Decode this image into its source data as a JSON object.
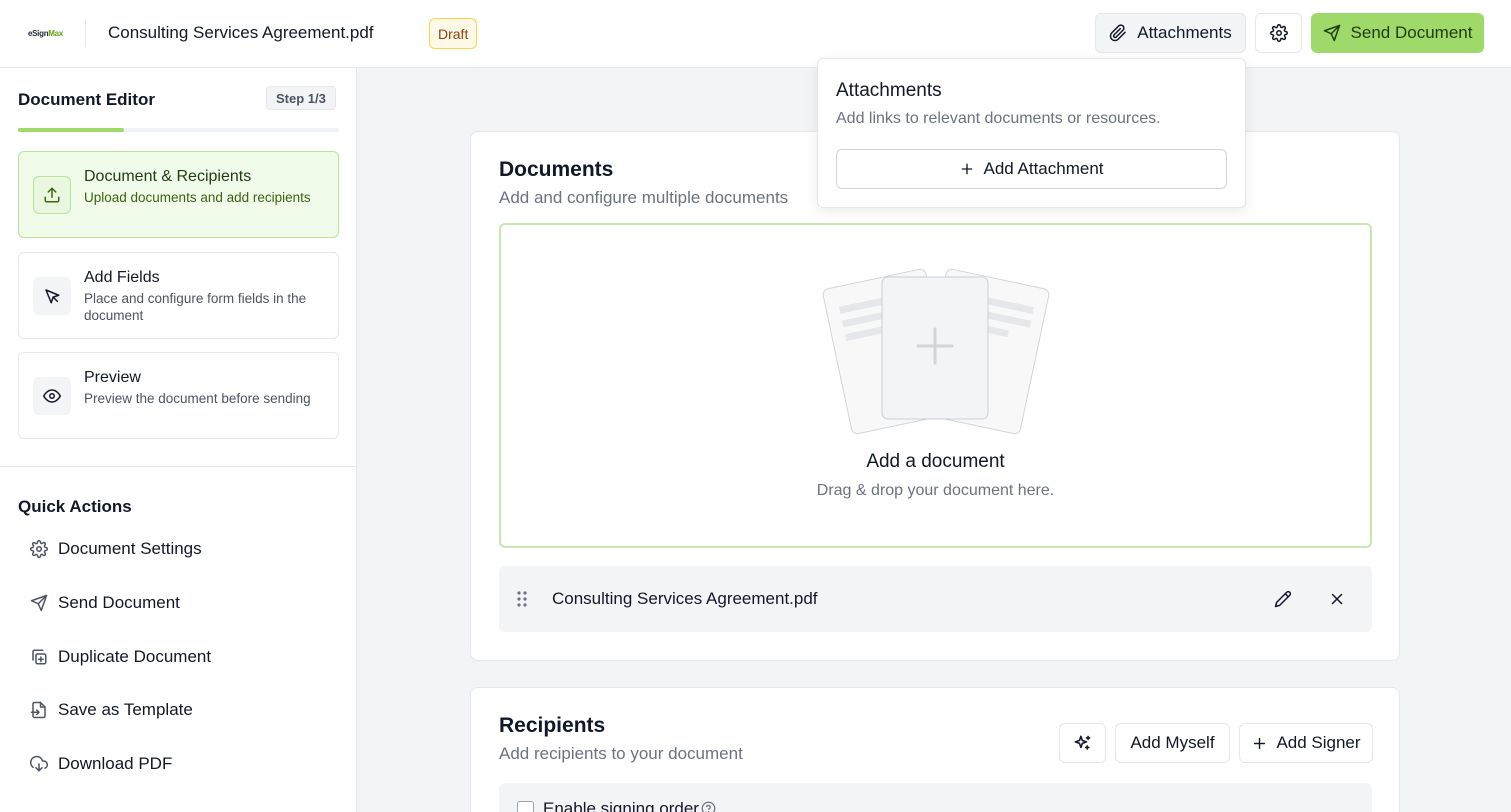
{
  "header": {
    "logo_text": "eSignMax",
    "document_title": "Consulting Services Agreement.pdf",
    "status_badge": "Draft",
    "attachments_label": "Attachments",
    "settings_icon": "gear-icon",
    "send_label": "Send Document"
  },
  "sidebar": {
    "title": "Document Editor",
    "step_badge": "Step 1/3",
    "progress": 0.33,
    "steps": [
      {
        "name": "Document & Recipients",
        "desc": "Upload documents and add recipients",
        "icon": "upload-icon",
        "active": true
      },
      {
        "name": "Add Fields",
        "desc": "Place and configure form fields in the document",
        "icon": "cursor-icon",
        "active": false
      },
      {
        "name": "Preview",
        "desc": "Preview the document before sending",
        "icon": "eye-icon",
        "active": false
      }
    ],
    "quick_actions_title": "Quick Actions",
    "quick_actions": [
      {
        "label": "Document Settings",
        "icon": "gear-icon"
      },
      {
        "label": "Send Document",
        "icon": "send-icon"
      },
      {
        "label": "Duplicate Document",
        "icon": "duplicate-icon"
      },
      {
        "label": "Save as Template",
        "icon": "template-icon"
      },
      {
        "label": "Download PDF",
        "icon": "download-icon"
      }
    ]
  },
  "documents": {
    "title": "Documents",
    "subtitle": "Add and configure multiple documents",
    "dropzone_title": "Add a document",
    "dropzone_subtitle": "Drag & drop your document here.",
    "files": [
      {
        "name": "Consulting Services Agreement.pdf"
      }
    ]
  },
  "recipients": {
    "title": "Recipients",
    "subtitle": "Add recipients to your document",
    "add_myself_label": "Add Myself",
    "add_signer_label": "Add Signer",
    "signing_order_label": "Enable signing order"
  },
  "attachments_popover": {
    "title": "Attachments",
    "subtitle": "Add links to relevant documents or resources.",
    "add_label": "Add Attachment"
  },
  "colors": {
    "accent": "#9ed96a",
    "accent_light": "#f0fbea",
    "draft_badge_bg": "#fef9e7"
  }
}
